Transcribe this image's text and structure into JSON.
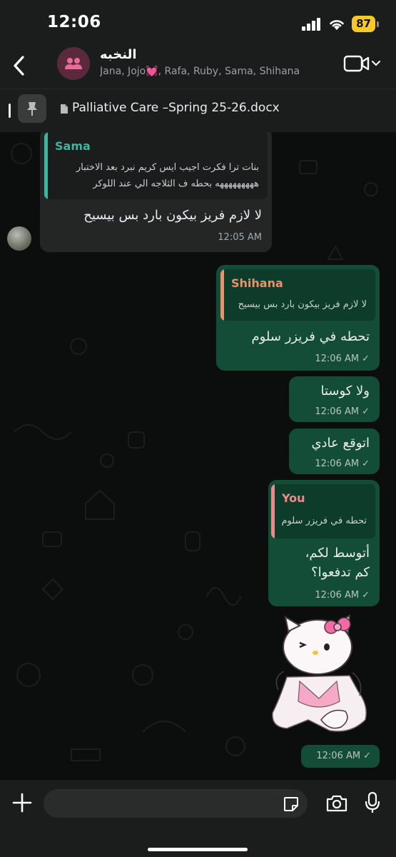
{
  "status_bar": {
    "time": "12:06",
    "battery": "87"
  },
  "header": {
    "group_name": "النخبه",
    "members": "Jana, Jojo💓, Rafa, Ruby, Sama, Shihana",
    "icons": {
      "back": "chevron-left-icon",
      "avatar": "group-icon",
      "video": "video-camera-icon",
      "menu": "chevron-down-icon"
    }
  },
  "pinned": {
    "file_name": "Palliative Care –Spring 25-26.docx",
    "icons": {
      "pin": "pin-icon",
      "doc": "document-icon"
    }
  },
  "messages": [
    {
      "direction": "incoming",
      "quote": {
        "name": "Sama",
        "color": "#3fb5a0",
        "lines": [
          "بنات ترا فكرت اجيب ايس كريم نبرد بعد الاختبار",
          "هههههههههه بحطه ف الثلاجه الي عند اللوكر"
        ]
      },
      "text": "لا لازم فريز بيكون بارد بس بيسيح",
      "time": "12:05 AM"
    },
    {
      "direction": "outgoing",
      "quote": {
        "name": "Shihana",
        "color": "#e8936a",
        "lines": [
          "لا لازم فريز بيكون بارد بس بيسيح"
        ]
      },
      "text": "تحطه في فريزر سلوم",
      "time": "12:06 AM"
    },
    {
      "direction": "outgoing",
      "text": "ولا كوستا",
      "time": "12:06 AM"
    },
    {
      "direction": "outgoing",
      "text": "اتوقع عادي",
      "time": "12:06 AM"
    },
    {
      "direction": "outgoing",
      "quote": {
        "name": "You",
        "color": "#f08a8a",
        "lines": [
          "تحطه في فريزر سلوم"
        ]
      },
      "text_lines": [
        "أتوسط لكم،",
        "كم تدفعوا؟"
      ],
      "time": "12:06 AM"
    },
    {
      "direction": "outgoing",
      "type": "sticker",
      "sticker": "hello-kitty-sticker",
      "time": "12:06 AM"
    }
  ],
  "input_bar": {
    "placeholder": "",
    "icons": {
      "plus": "plus-icon",
      "sticker": "sticker-icon",
      "camera": "camera-icon",
      "mic": "microphone-icon"
    }
  },
  "colors": {
    "outgoing_bubble": "#134d37",
    "incoming_bubble": "#242626",
    "battery": "#f5c82b"
  }
}
